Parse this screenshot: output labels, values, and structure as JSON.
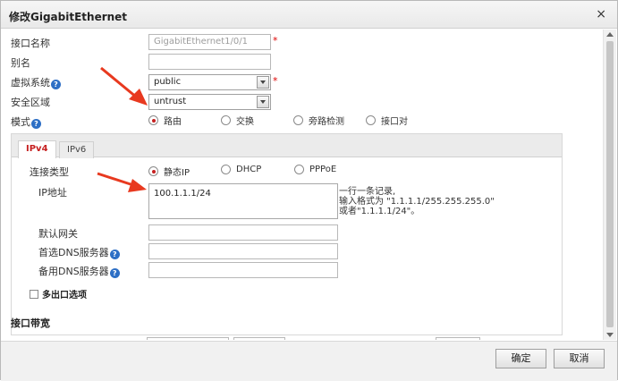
{
  "dialog": {
    "title": "修改GigabitEthernet",
    "close_glyph": "×"
  },
  "form": {
    "interface_name": {
      "label": "接口名称",
      "value": "GigabitEthernet1/0/1",
      "required": "*"
    },
    "alias": {
      "label": "别名",
      "value": ""
    },
    "virtual_system": {
      "label": "虚拟系统",
      "value": "public",
      "required": "*"
    },
    "security_zone": {
      "label": "安全区域",
      "value": "untrust"
    },
    "mode": {
      "label": "模式",
      "options": [
        "路由",
        "交换",
        "旁路检测",
        "接口对"
      ],
      "selected": "路由"
    }
  },
  "tabs": [
    {
      "label": "IPv4",
      "active": true
    },
    {
      "label": "IPv6",
      "active": false
    }
  ],
  "ipv4": {
    "connection_type": {
      "label": "连接类型",
      "options": [
        "静态IP",
        "DHCP",
        "PPPoE"
      ],
      "selected": "静态IP"
    },
    "ip_address": {
      "label": "IP地址",
      "value": "100.1.1.1/24"
    },
    "hint": [
      "一行一条记录,",
      "输入格式为 \"1.1.1.1/255.255.255.0\"",
      "或者\"1.1.1.1/24\"。"
    ],
    "gateway": {
      "label": "默认网关",
      "value": ""
    },
    "dns_primary": {
      "label": "首选DNS服务器",
      "value": ""
    },
    "dns_secondary": {
      "label": "备用DNS服务器",
      "value": ""
    },
    "multi_egress": {
      "label": "多出口选项",
      "checked": false
    }
  },
  "bandwidth": {
    "label": "接口带宽"
  },
  "buttons": {
    "ok": "确定",
    "cancel": "取消"
  },
  "help_glyph": "?",
  "colors": {
    "accent_red": "#c62020",
    "help_blue": "#2d6fc5",
    "annotation_arrow": "#e8391f"
  },
  "icons": [
    "close-icon",
    "help-icon",
    "dropdown-arrow-icon",
    "scroll-up-icon",
    "scroll-down-icon",
    "annotation-arrow-icon"
  ]
}
